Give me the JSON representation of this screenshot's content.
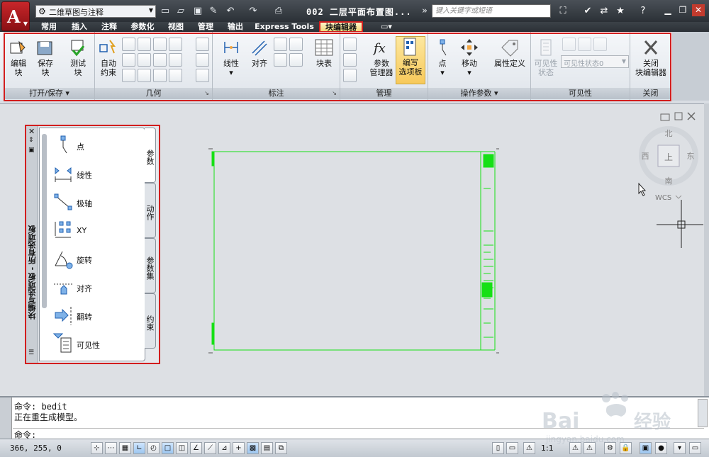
{
  "title_bar": {
    "workspace": "二维草图与注释",
    "document_title": "002 二层平面布置图...",
    "search_placeholder": "键入关键字或短语"
  },
  "tabs": [
    {
      "label": "常用"
    },
    {
      "label": "插入"
    },
    {
      "label": "注释"
    },
    {
      "label": "参数化"
    },
    {
      "label": "视图"
    },
    {
      "label": "管理"
    },
    {
      "label": "输出"
    },
    {
      "label": "Express Tools"
    },
    {
      "label": "块编辑器",
      "active": true
    }
  ],
  "ribbon": {
    "open_save": {
      "title": "打开/保存",
      "edit_block": "编辑\n块",
      "save_block": "保存\n块",
      "test_block": "测试\n块"
    },
    "geometry": {
      "title": "几何",
      "auto_constrain": "自动\n约束"
    },
    "dimension": {
      "title": "标注",
      "linear": "线性",
      "aligned": "对齐"
    },
    "block_table": {
      "label": "块表"
    },
    "manage": {
      "title": "管理",
      "param_manager": "参数\n管理器",
      "authoring_palettes": "编写\n选项板"
    },
    "action_params": {
      "title": "操作参数",
      "point": "点",
      "move": "移动",
      "attribute_definition": "属性定义"
    },
    "visibility": {
      "title": "可见性",
      "visibility_states": "可见性\n状态",
      "state_select": "可见性状态0"
    },
    "close": {
      "title": "关闭",
      "close_editor": "关闭\n块编辑器"
    }
  },
  "palette": {
    "title": "块编写选项板 - 所有选项板",
    "items": [
      {
        "label": "点"
      },
      {
        "label": "线性"
      },
      {
        "label": "极轴"
      },
      {
        "label": "XY"
      },
      {
        "label": "旋转"
      },
      {
        "label": "对齐"
      },
      {
        "label": "翻转"
      },
      {
        "label": "可见性"
      }
    ],
    "tabs": [
      {
        "label": "参数",
        "active": true
      },
      {
        "label": "动作"
      },
      {
        "label": "参数集"
      },
      {
        "label": "约束"
      }
    ]
  },
  "viewcube": {
    "north": "北",
    "south": "南",
    "east": "东",
    "west": "西",
    "top": "上",
    "wcs": "WCS"
  },
  "command": {
    "line1": "命令: bedit",
    "line2": "正在重生成模型。",
    "prompt": "命令:"
  },
  "status": {
    "coords": "366, 255, 0",
    "scale": "1:1"
  },
  "colors": {
    "accent_red": "#d21e1e",
    "drawing_green": "#16e016"
  }
}
